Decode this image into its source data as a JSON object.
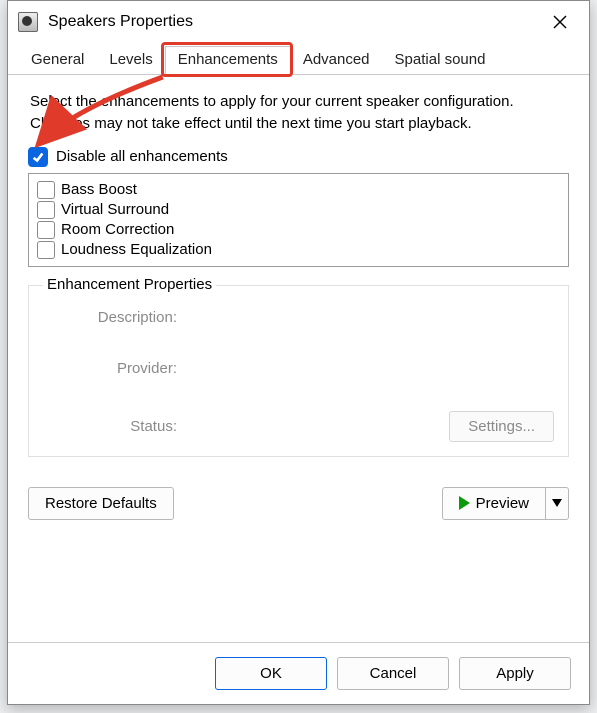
{
  "window": {
    "title": "Speakers Properties"
  },
  "tabs": {
    "general": "General",
    "levels": "Levels",
    "enhancements": "Enhancements",
    "advanced": "Advanced",
    "spatial": "Spatial sound"
  },
  "instructions": "Select the enhancements to apply for your current speaker configuration. Changes may not take effect until the next time you start playback.",
  "disable_all_label": "Disable all enhancements",
  "disable_all_checked": true,
  "enhancements": [
    {
      "label": "Bass Boost",
      "checked": false
    },
    {
      "label": "Virtual Surround",
      "checked": false
    },
    {
      "label": "Room Correction",
      "checked": false
    },
    {
      "label": "Loudness Equalization",
      "checked": false
    }
  ],
  "props": {
    "legend": "Enhancement Properties",
    "description_label": "Description:",
    "provider_label": "Provider:",
    "status_label": "Status:",
    "settings_label": "Settings..."
  },
  "buttons": {
    "restore": "Restore Defaults",
    "preview": "Preview",
    "ok": "OK",
    "cancel": "Cancel",
    "apply": "Apply"
  },
  "annotations": {
    "highlight_tab": "enhancements",
    "arrow_to": "disable-all-checkbox"
  }
}
